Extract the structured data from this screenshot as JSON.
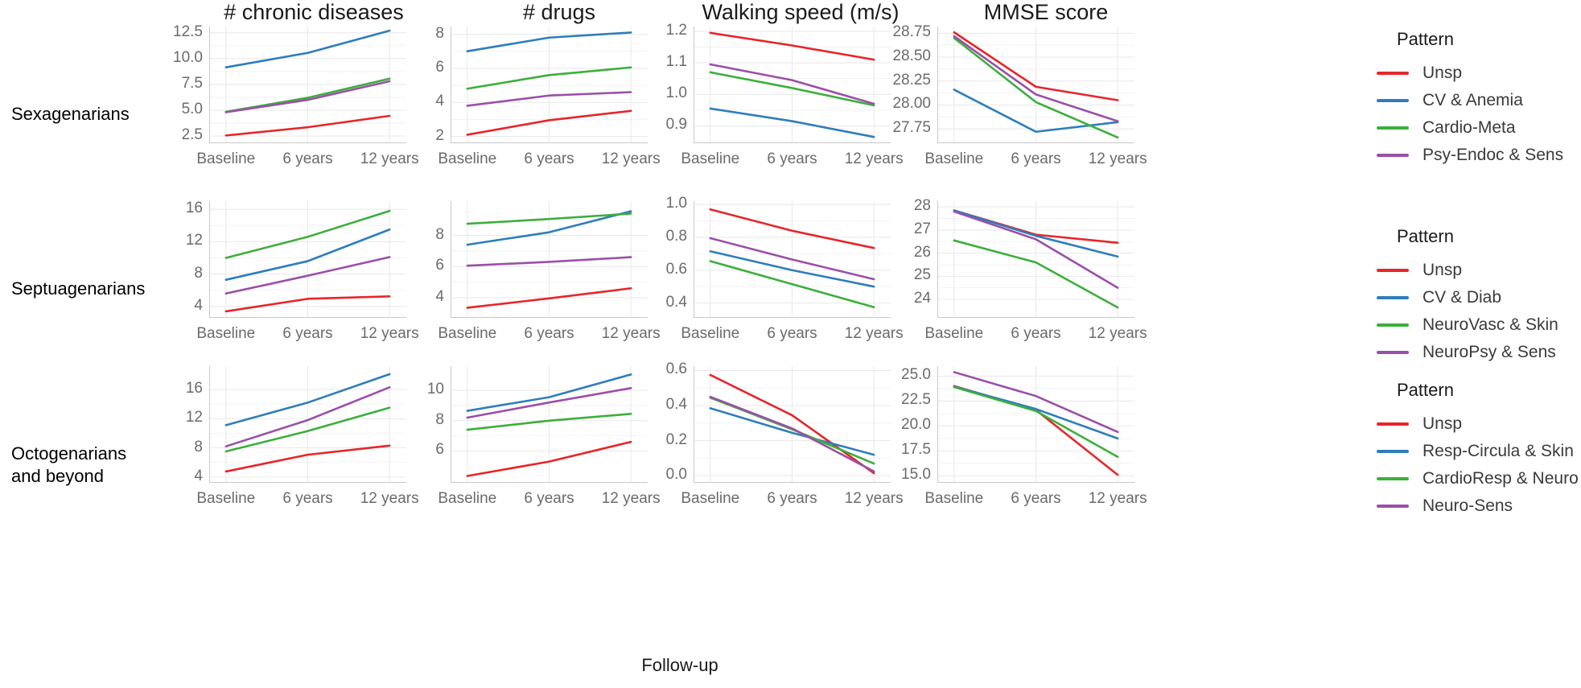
{
  "figure": {
    "xaxis_title": "Follow-up",
    "background": "#ffffff",
    "grid_color": "#e8e8e8",
    "axis_text_color": "#6b6b6b"
  },
  "columns": [
    {
      "title": "# chronic diseases"
    },
    {
      "title": "# drugs"
    },
    {
      "title": "Walking speed (m/s)"
    },
    {
      "title": "MMSE score"
    }
  ],
  "rows": [
    {
      "label": "Sexagenarians"
    },
    {
      "label": "Septuagenarians"
    },
    {
      "label": "Octogenarians\nand beyond"
    }
  ],
  "x_categories": [
    "Baseline",
    "6 years",
    "12 years"
  ],
  "colors": {
    "red": "#E8252A",
    "blue": "#2E7EBB",
    "green": "#3CAF3C",
    "purple": "#9B4FA8"
  },
  "legends": [
    {
      "title": "Pattern",
      "entries": [
        {
          "label": "Unsp",
          "color": "#E8252A"
        },
        {
          "label": "CV & Anemia",
          "color": "#2E7EBB"
        },
        {
          "label": "Cardio-Meta",
          "color": "#3CAF3C"
        },
        {
          "label": "Psy-Endoc & Sens",
          "color": "#9B4FA8"
        }
      ]
    },
    {
      "title": "Pattern",
      "entries": [
        {
          "label": "Unsp",
          "color": "#E8252A"
        },
        {
          "label": "CV & Diab",
          "color": "#2E7EBB"
        },
        {
          "label": "NeuroVasc & Skin",
          "color": "#3CAF3C"
        },
        {
          "label": "NeuroPsy & Sens",
          "color": "#9B4FA8"
        }
      ]
    },
    {
      "title": "Pattern",
      "entries": [
        {
          "label": "Unsp",
          "color": "#E8252A"
        },
        {
          "label": "Resp-Circula & Skin",
          "color": "#2E7EBB"
        },
        {
          "label": "CardioResp & Neuro",
          "color": "#3CAF3C"
        },
        {
          "label": "Neuro-Sens",
          "color": "#9B4FA8"
        }
      ]
    }
  ],
  "chart_data": [
    {
      "id": "r1c1",
      "type": "line",
      "title": "# chronic diseases",
      "row": "Sexagenarians",
      "xlabel": "Follow-up",
      "ylabel": "",
      "x": [
        "Baseline",
        "6 years",
        "12 years"
      ],
      "yticks": [
        2.5,
        5.0,
        7.5,
        10.0,
        12.5
      ],
      "ytick_labels": [
        "2.5",
        "5.0",
        "7.5",
        "10.0",
        "12.5"
      ],
      "ylim": [
        1.8,
        13.1
      ],
      "grid": true,
      "legend": "right",
      "series": [
        {
          "name": "Unsp",
          "color": "#E8252A",
          "values": [
            2.55,
            3.35,
            4.45
          ]
        },
        {
          "name": "CV & Anemia",
          "color": "#2E7EBB",
          "values": [
            9.15,
            10.55,
            12.7
          ]
        },
        {
          "name": "Cardio-Meta",
          "color": "#3CAF3C",
          "values": [
            4.85,
            6.2,
            8.05
          ]
        },
        {
          "name": "Psy-Endoc & Sens",
          "color": "#9B4FA8",
          "values": [
            4.8,
            6.0,
            7.8
          ]
        }
      ]
    },
    {
      "id": "r1c2",
      "type": "line",
      "title": "# drugs",
      "row": "Sexagenarians",
      "x": [
        "Baseline",
        "6 years",
        "12 years"
      ],
      "yticks": [
        2,
        4,
        6,
        8
      ],
      "ytick_labels": [
        "2",
        "4",
        "6",
        "8"
      ],
      "ylim": [
        1.6,
        8.45
      ],
      "grid": true,
      "series": [
        {
          "name": "Unsp",
          "color": "#E8252A",
          "values": [
            2.1,
            2.95,
            3.5
          ]
        },
        {
          "name": "CV & Anemia",
          "color": "#2E7EBB",
          "values": [
            7.0,
            7.8,
            8.1
          ]
        },
        {
          "name": "Cardio-Meta",
          "color": "#3CAF3C",
          "values": [
            4.8,
            5.6,
            6.05
          ]
        },
        {
          "name": "Psy-Endoc & Sens",
          "color": "#9B4FA8",
          "values": [
            3.8,
            4.4,
            4.6
          ]
        }
      ]
    },
    {
      "id": "r1c3",
      "type": "line",
      "title": "Walking speed (m/s)",
      "row": "Sexagenarians",
      "x": [
        "Baseline",
        "6 years",
        "12 years"
      ],
      "yticks": [
        0.9,
        1.0,
        1.1,
        1.2
      ],
      "ytick_labels": [
        "0.9",
        "1.0",
        "1.1",
        "1.2"
      ],
      "ylim": [
        0.845,
        1.215
      ],
      "grid": true,
      "series": [
        {
          "name": "Unsp",
          "color": "#E8252A",
          "values": [
            1.195,
            1.155,
            1.11
          ]
        },
        {
          "name": "CV & Anemia",
          "color": "#2E7EBB",
          "values": [
            0.955,
            0.915,
            0.865
          ]
        },
        {
          "name": "Cardio-Meta",
          "color": "#3CAF3C",
          "values": [
            1.07,
            1.02,
            0.965
          ]
        },
        {
          "name": "Psy-Endoc & Sens",
          "color": "#9B4FA8",
          "values": [
            1.095,
            1.045,
            0.97
          ]
        }
      ]
    },
    {
      "id": "r1c4",
      "type": "line",
      "title": "MMSE score",
      "row": "Sexagenarians",
      "x": [
        "Baseline",
        "6 years",
        "12 years"
      ],
      "yticks": [
        27.75,
        28.0,
        28.25,
        28.5,
        28.75
      ],
      "ytick_labels": [
        "27.75",
        "28.00",
        "28.25",
        "28.50",
        "28.75"
      ],
      "ylim": [
        27.6,
        28.82
      ],
      "grid": true,
      "series": [
        {
          "name": "Unsp",
          "color": "#E8252A",
          "values": [
            28.76,
            28.19,
            28.05
          ]
        },
        {
          "name": "CV & Anemia",
          "color": "#2E7EBB",
          "values": [
            28.16,
            27.72,
            27.82
          ]
        },
        {
          "name": "Cardio-Meta",
          "color": "#3CAF3C",
          "values": [
            28.7,
            28.03,
            27.66
          ]
        },
        {
          "name": "Psy-Endoc & Sens",
          "color": "#9B4FA8",
          "values": [
            28.72,
            28.11,
            27.83
          ]
        }
      ]
    },
    {
      "id": "r2c1",
      "type": "line",
      "title": "# chronic diseases",
      "row": "Septuagenarians",
      "x": [
        "Baseline",
        "6 years",
        "12 years"
      ],
      "yticks": [
        4,
        8,
        12,
        16
      ],
      "ytick_labels": [
        "4",
        "8",
        "12",
        "16"
      ],
      "ylim": [
        2.6,
        17.0
      ],
      "grid": true,
      "series": [
        {
          "name": "Unsp",
          "color": "#E8252A",
          "values": [
            3.4,
            4.95,
            5.25
          ]
        },
        {
          "name": "CV & Diab",
          "color": "#2E7EBB",
          "values": [
            7.3,
            9.6,
            13.5
          ]
        },
        {
          "name": "NeuroVasc & Skin",
          "color": "#3CAF3C",
          "values": [
            10.0,
            12.6,
            15.8
          ]
        },
        {
          "name": "NeuroPsy & Sens",
          "color": "#9B4FA8",
          "values": [
            5.6,
            7.8,
            10.1
          ]
        }
      ]
    },
    {
      "id": "r2c2",
      "type": "line",
      "title": "# drugs",
      "row": "Septuagenarians",
      "x": [
        "Baseline",
        "6 years",
        "12 years"
      ],
      "yticks": [
        4,
        6,
        8
      ],
      "ytick_labels": [
        "4",
        "6",
        "8"
      ],
      "ylim": [
        2.7,
        10.2
      ],
      "grid": true,
      "series": [
        {
          "name": "Unsp",
          "color": "#E8252A",
          "values": [
            3.35,
            3.95,
            4.6
          ]
        },
        {
          "name": "CV & Diab",
          "color": "#2E7EBB",
          "values": [
            7.4,
            8.2,
            9.55
          ]
        },
        {
          "name": "NeuroVasc & Skin",
          "color": "#3CAF3C",
          "values": [
            8.75,
            9.05,
            9.4
          ]
        },
        {
          "name": "NeuroPsy & Sens",
          "color": "#9B4FA8",
          "values": [
            6.05,
            6.3,
            6.6
          ]
        }
      ]
    },
    {
      "id": "r2c3",
      "type": "line",
      "title": "Walking speed (m/s)",
      "row": "Septuagenarians",
      "x": [
        "Baseline",
        "6 years",
        "12 years"
      ],
      "yticks": [
        0.4,
        0.6,
        0.8,
        1.0
      ],
      "ytick_labels": [
        "0.4",
        "0.6",
        "0.8",
        "1.0"
      ],
      "ylim": [
        0.31,
        1.02
      ],
      "grid": true,
      "series": [
        {
          "name": "Unsp",
          "color": "#E8252A",
          "values": [
            0.97,
            0.84,
            0.735
          ]
        },
        {
          "name": "CV & Diab",
          "color": "#2E7EBB",
          "values": [
            0.715,
            0.6,
            0.5
          ]
        },
        {
          "name": "NeuroVasc & Skin",
          "color": "#3CAF3C",
          "values": [
            0.655,
            0.515,
            0.375
          ]
        },
        {
          "name": "NeuroPsy & Sens",
          "color": "#9B4FA8",
          "values": [
            0.795,
            0.665,
            0.545
          ]
        }
      ]
    },
    {
      "id": "r2c4",
      "type": "line",
      "title": "MMSE score",
      "row": "Septuagenarians",
      "x": [
        "Baseline",
        "6 years",
        "12 years"
      ],
      "yticks": [
        24,
        25,
        26,
        27,
        28
      ],
      "ytick_labels": [
        "24",
        "25",
        "26",
        "27",
        "28"
      ],
      "ylim": [
        23.2,
        28.25
      ],
      "grid": true,
      "series": [
        {
          "name": "Unsp",
          "color": "#E8252A",
          "values": [
            27.85,
            26.8,
            26.45
          ]
        },
        {
          "name": "CV & Diab",
          "color": "#2E7EBB",
          "values": [
            27.85,
            26.75,
            25.85
          ]
        },
        {
          "name": "NeuroVasc & Skin",
          "color": "#3CAF3C",
          "values": [
            26.55,
            25.6,
            23.65
          ]
        },
        {
          "name": "NeuroPsy & Sens",
          "color": "#9B4FA8",
          "values": [
            27.8,
            26.6,
            24.5
          ]
        }
      ]
    },
    {
      "id": "r3c1",
      "type": "line",
      "title": "# chronic diseases",
      "row": "Octogenarians and beyond",
      "x": [
        "Baseline",
        "6 years",
        "12 years"
      ],
      "yticks": [
        4,
        8,
        12,
        16
      ],
      "ytick_labels": [
        "4",
        "8",
        "12",
        "16"
      ],
      "ylim": [
        3.2,
        19.2
      ],
      "grid": true,
      "series": [
        {
          "name": "Unsp",
          "color": "#E8252A",
          "values": [
            4.75,
            7.05,
            8.3
          ]
        },
        {
          "name": "Resp-Circula & Skin",
          "color": "#2E7EBB",
          "values": [
            11.1,
            14.2,
            18.1
          ]
        },
        {
          "name": "CardioResp & Neuro",
          "color": "#3CAF3C",
          "values": [
            7.5,
            10.3,
            13.5
          ]
        },
        {
          "name": "Neuro-Sens",
          "color": "#9B4FA8",
          "values": [
            8.2,
            11.8,
            16.3
          ]
        }
      ]
    },
    {
      "id": "r3c2",
      "type": "line",
      "title": "# drugs",
      "row": "Octogenarians and beyond",
      "x": [
        "Baseline",
        "6 years",
        "12 years"
      ],
      "yticks": [
        6,
        8,
        10
      ],
      "ytick_labels": [
        "6",
        "8",
        "10"
      ],
      "ylim": [
        3.9,
        11.6
      ],
      "grid": true,
      "series": [
        {
          "name": "Unsp",
          "color": "#E8252A",
          "values": [
            4.35,
            5.3,
            6.6
          ]
        },
        {
          "name": "Resp-Circula & Skin",
          "color": "#2E7EBB",
          "values": [
            8.65,
            9.55,
            11.05
          ]
        },
        {
          "name": "CardioResp & Neuro",
          "color": "#3CAF3C",
          "values": [
            7.4,
            8.0,
            8.45
          ]
        },
        {
          "name": "Neuro-Sens",
          "color": "#9B4FA8",
          "values": [
            8.2,
            9.2,
            10.15
          ]
        }
      ]
    },
    {
      "id": "r3c3",
      "type": "line",
      "title": "Walking speed (m/s)",
      "row": "Octogenarians and beyond",
      "x": [
        "Baseline",
        "6 years",
        "12 years"
      ],
      "yticks": [
        0.0,
        0.2,
        0.4,
        0.6
      ],
      "ytick_labels": [
        "0.0",
        "0.2",
        "0.4",
        "0.6"
      ],
      "ylim": [
        -0.04,
        0.625
      ],
      "grid": true,
      "series": [
        {
          "name": "Unsp",
          "color": "#E8252A",
          "values": [
            0.575,
            0.345,
            0.015
          ]
        },
        {
          "name": "Resp-Circula & Skin",
          "color": "#2E7EBB",
          "values": [
            0.385,
            0.245,
            0.12
          ]
        },
        {
          "name": "CardioResp & Neuro",
          "color": "#3CAF3C",
          "values": [
            0.445,
            0.265,
            0.07
          ]
        },
        {
          "name": "Neuro-Sens",
          "color": "#9B4FA8",
          "values": [
            0.45,
            0.27,
            0.025
          ]
        }
      ]
    },
    {
      "id": "r3c4",
      "type": "line",
      "title": "MMSE score",
      "row": "Octogenarians and beyond",
      "x": [
        "Baseline",
        "6 years",
        "12 years"
      ],
      "yticks": [
        15.0,
        17.5,
        20.0,
        22.5,
        25.0
      ],
      "ytick_labels": [
        "15.0",
        "17.5",
        "20.0",
        "22.5",
        "25.0"
      ],
      "ylim": [
        14.3,
        26.0
      ],
      "grid": true,
      "series": [
        {
          "name": "Unsp",
          "color": "#E8252A",
          "values": [
            24.0,
            21.6,
            15.1
          ]
        },
        {
          "name": "Resp-Circula & Skin",
          "color": "#2E7EBB",
          "values": [
            23.95,
            21.7,
            18.75
          ]
        },
        {
          "name": "CardioResp & Neuro",
          "color": "#3CAF3C",
          "values": [
            23.9,
            21.5,
            16.9
          ]
        },
        {
          "name": "Neuro-Sens",
          "color": "#9B4FA8",
          "values": [
            25.4,
            23.0,
            19.4
          ]
        }
      ]
    }
  ]
}
